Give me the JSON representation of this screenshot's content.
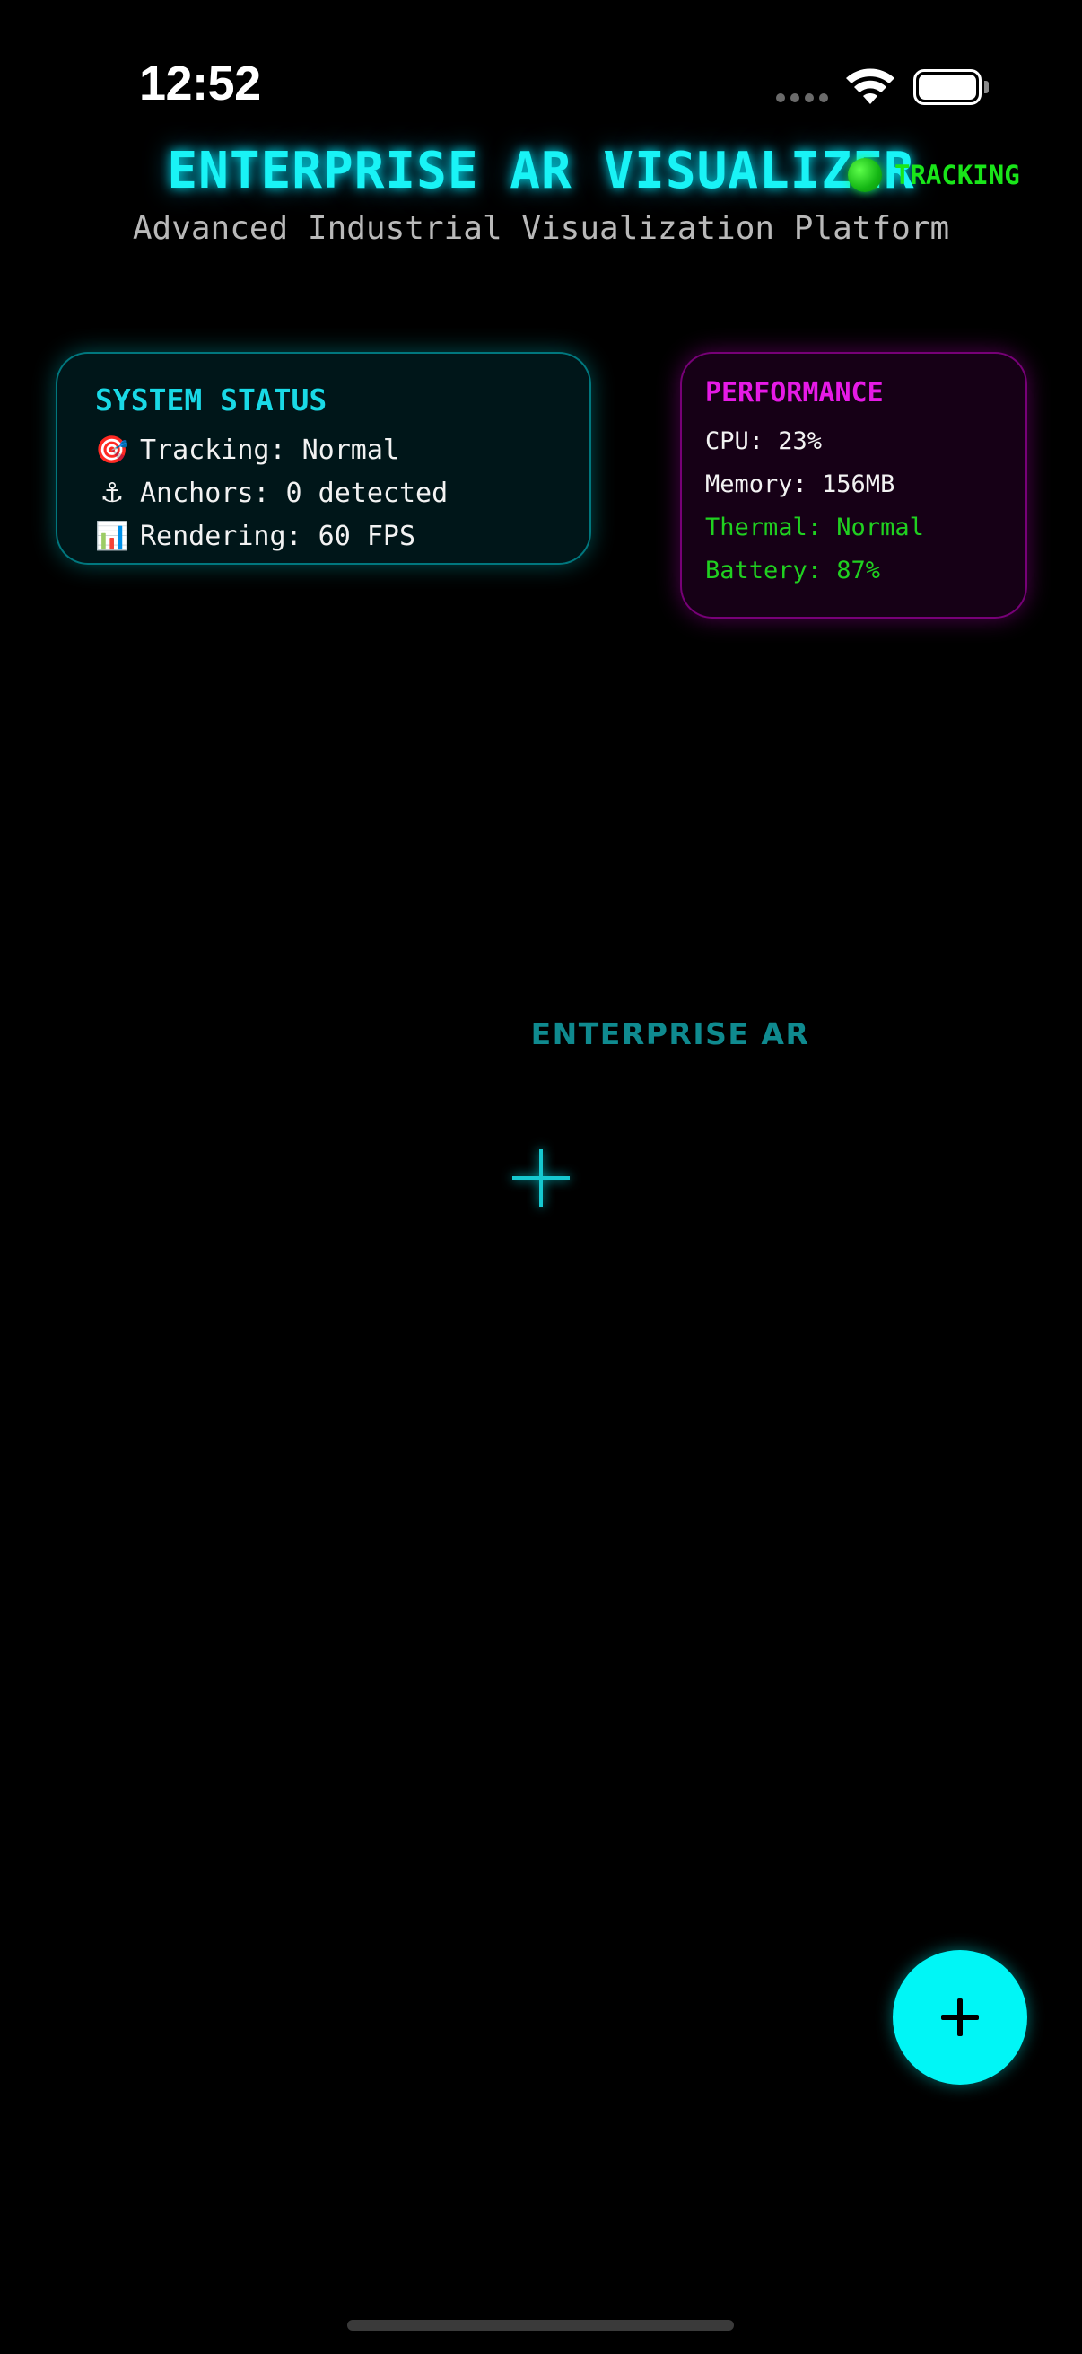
{
  "status_bar": {
    "time": "12:52",
    "icons": [
      "cellular-dots-icon",
      "wifi-icon",
      "battery-icon"
    ]
  },
  "header": {
    "title": "ENTERPRISE AR VISUALIZER",
    "subtitle": "Advanced Industrial Visualization Platform",
    "tracking_label": "TRACKING"
  },
  "system_status": {
    "title": "SYSTEM STATUS",
    "items": [
      {
        "icon": "🎯",
        "icon_name": "target-icon",
        "text": "Tracking: Normal"
      },
      {
        "icon": "⚓",
        "icon_name": "anchor-icon",
        "text": "Anchors: 0 detected"
      },
      {
        "icon": "📊",
        "icon_name": "chart-icon",
        "text": "Rendering: 60 FPS"
      }
    ]
  },
  "performance": {
    "title": "PERFORMANCE",
    "cpu": "CPU: 23%",
    "memory": "Memory: 156MB",
    "thermal": "Thermal: Normal",
    "battery": "Battery: 87%"
  },
  "ar_view": {
    "label": "ENTERPRISE AR"
  },
  "fab": {
    "label": "+",
    "icon": "plus-icon"
  },
  "colors": {
    "accent_cyan": "#19f3f6",
    "accent_magenta": "#e61ae6",
    "status_green": "#20d020",
    "background": "#000000"
  }
}
